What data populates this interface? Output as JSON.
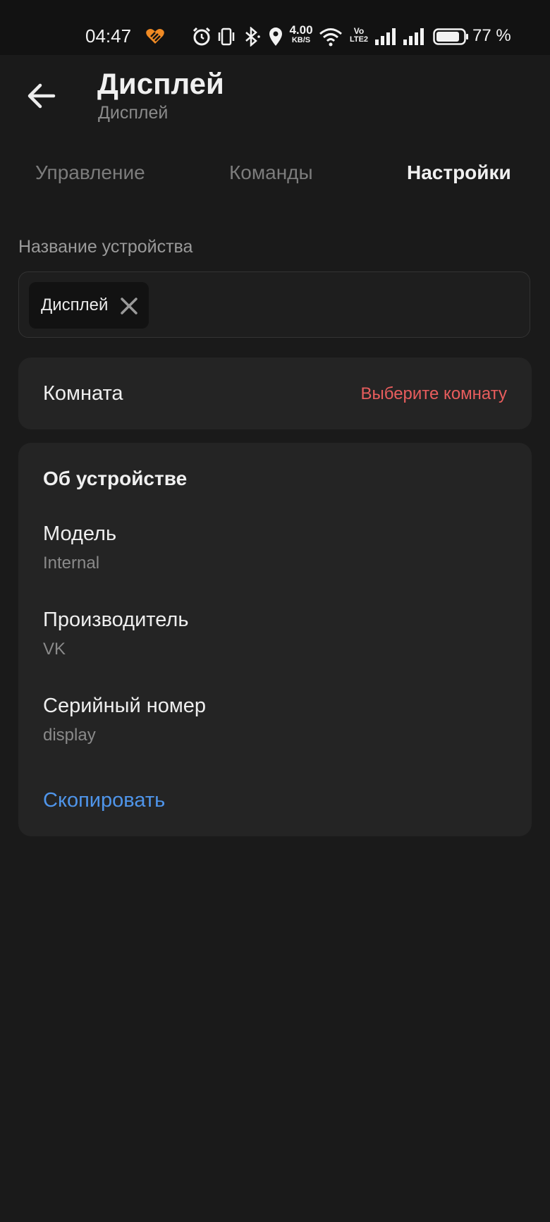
{
  "status_bar": {
    "time": "04:47",
    "net_speed_value": "4.00",
    "net_speed_unit": "KB/S",
    "volte_top": "Vo",
    "volte_bottom": "LTE2",
    "battery_percent": "77 %",
    "icons": [
      "app-heart-icon",
      "alarm-icon",
      "vibrate-icon",
      "bluetooth-icon",
      "location-icon",
      "wifi-icon",
      "volte-icon",
      "signal-icon",
      "signal-icon",
      "battery-icon"
    ],
    "accent": "#f08a24"
  },
  "header": {
    "title": "Дисплей",
    "subtitle": "Дисплей"
  },
  "tabs": [
    {
      "label": "Управление",
      "active": false
    },
    {
      "label": "Команды",
      "active": false
    },
    {
      "label": "Настройки",
      "active": true
    }
  ],
  "device_name": {
    "label": "Название устройства",
    "chip_value": "Дисплей"
  },
  "room": {
    "label": "Комната",
    "value": "Выберите комнату",
    "value_color": "#e85d5d"
  },
  "about": {
    "title": "Об устройстве",
    "fields": [
      {
        "label": "Модель",
        "value": "Internal"
      },
      {
        "label": "Производитель",
        "value": "VK"
      },
      {
        "label": "Серийный номер",
        "value": "display"
      }
    ],
    "copy_label": "Скопировать",
    "copy_color": "#4f95ea"
  }
}
